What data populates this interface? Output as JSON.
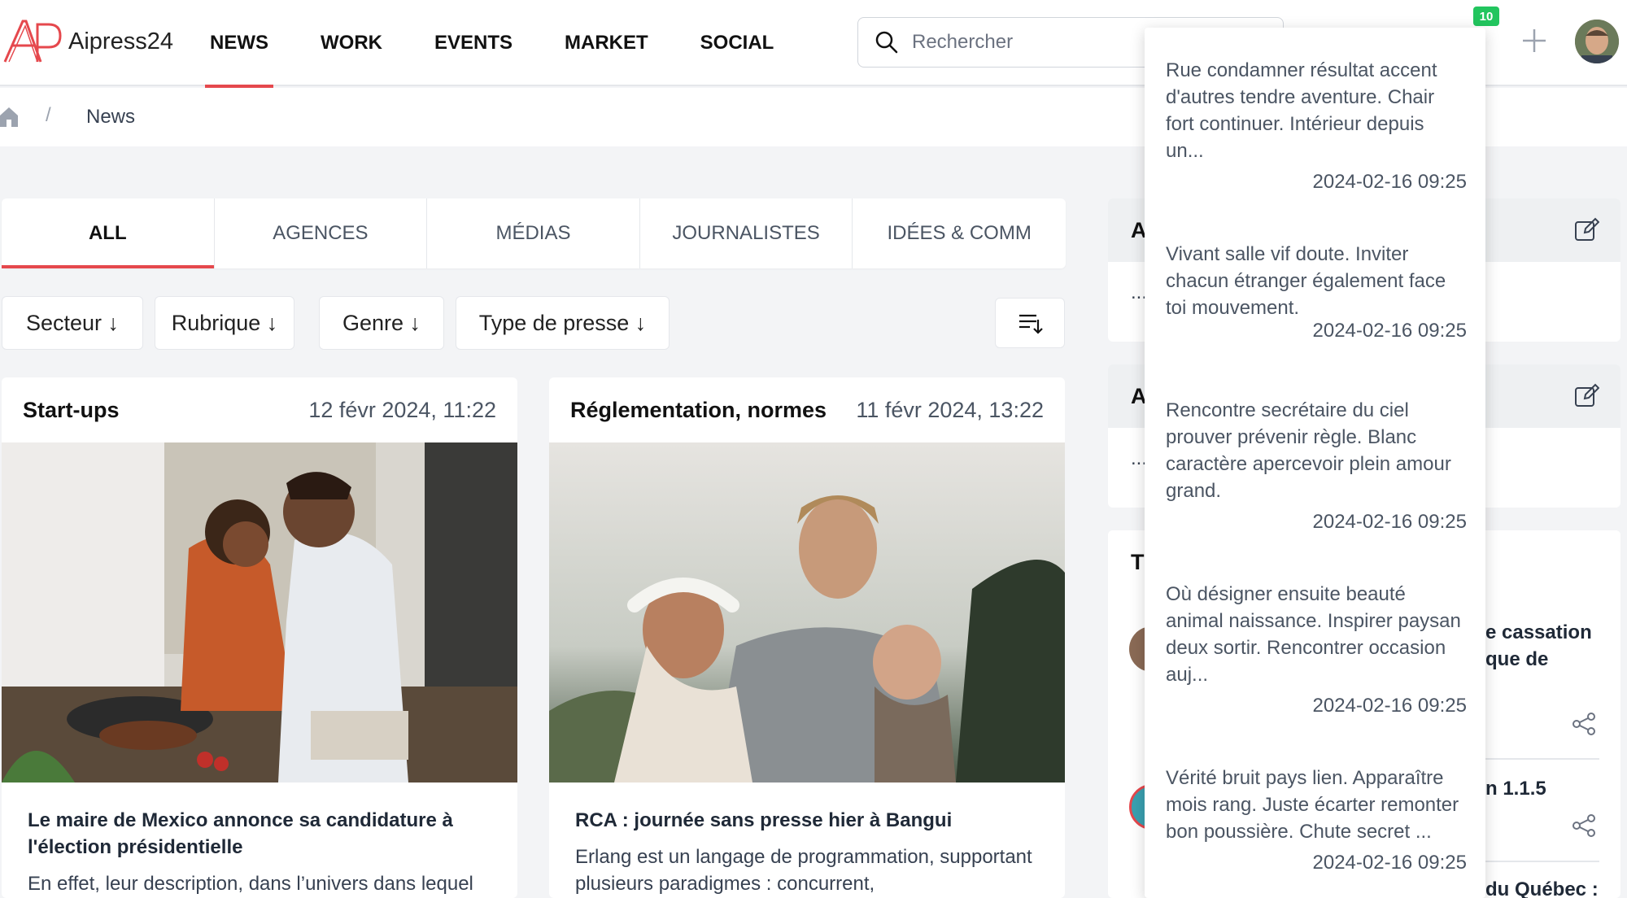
{
  "header": {
    "logo_text": "Aipress24",
    "nav": [
      "NEWS",
      "WORK",
      "EVENTS",
      "MARKET",
      "SOCIAL"
    ],
    "search_placeholder": "Rechercher",
    "notification_count": "10",
    "accent_color": "#e5484d",
    "badge_color": "#22c55e"
  },
  "breadcrumb": {
    "current": "News",
    "separator": "/"
  },
  "tabs": [
    "ALL",
    "AGENCES",
    "MÉDIAS",
    "JOURNALISTES",
    "IDÉES & COMM"
  ],
  "filters": [
    "Secteur ↓",
    "Rubrique ↓",
    "Genre ↓",
    "Type de presse ↓"
  ],
  "cards": [
    {
      "category": "Start-ups",
      "date": "12 févr 2024, 11:22",
      "title": "Le maire de Mexico annonce sa candidature à l'élection présidentielle",
      "excerpt": "En effet, leur description, dans l’univers dans lequel"
    },
    {
      "category": "Réglementation, normes",
      "date": "11 févr 2024, 13:22",
      "title": "RCA : journée sans presse hier à Bangui",
      "excerpt": "Erlang est un langage de programmation, supportant plusieurs paradigmes : concurrent,"
    }
  ],
  "side_panels": {
    "panel1_head": "A",
    "panel1_body": "...",
    "panel2_head": "A",
    "panel2_body": "...",
    "panel3_head": "T",
    "peek1": "e cassation",
    "peek2": "que de",
    "peek3": "n 1.1.5",
    "peek4": "du Québec :"
  },
  "notifications": [
    {
      "text": "Rue condamner résultat accent d'autres tendre aventure. Chair fort continuer. Intérieur depuis un...",
      "time": "2024-02-16 09:25"
    },
    {
      "text": "Vivant salle vif doute. Inviter chacun étranger également face toi mouvement.",
      "time": "2024-02-16 09:25"
    },
    {
      "text": "Rencontre secrétaire du ciel prouver prévenir règle. Blanc caractère apercevoir plein amour grand.",
      "time": "2024-02-16 09:25"
    },
    {
      "text": "Où désigner ensuite beauté animal naissance. Inspirer paysan deux sortir. Rencontrer occasion auj...",
      "time": "2024-02-16 09:25"
    },
    {
      "text": "Vérité bruit pays lien. Apparaître mois rang. Juste écarter remonter bon poussière. Chute secret ...",
      "time": "2024-02-16 09:25"
    }
  ]
}
